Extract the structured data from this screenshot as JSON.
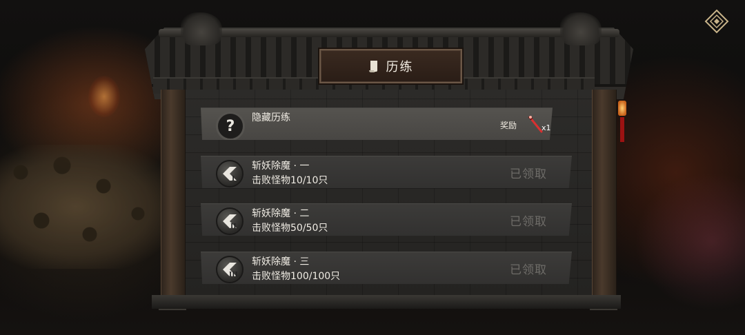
{
  "title": "历练",
  "hidden_task": {
    "name": "隐藏历练",
    "badge_icon": "question-mark-icon",
    "reward_label": "奖励",
    "reward_item_icon": "red-sword-icon",
    "reward_count": "x1"
  },
  "tasks": [
    {
      "name": "斩妖除魔 · 一",
      "progress": "击败怪物10/10只",
      "status": "已领取",
      "tier": "I"
    },
    {
      "name": "斩妖除魔 · 二",
      "progress": "击败怪物50/50只",
      "status": "已领取",
      "tier": "II"
    },
    {
      "name": "斩妖除魔 · 三",
      "progress": "击败怪物100/100只",
      "status": "已领取",
      "tier": "III"
    }
  ],
  "corner_button_icon": "diamond-menu-icon",
  "colors": {
    "accent": "#c9b48a",
    "claimed": "#6e6c68",
    "row": "#3c3b39"
  }
}
